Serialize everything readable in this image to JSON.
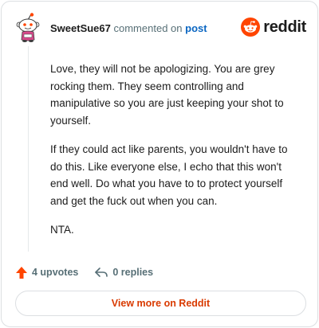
{
  "header": {
    "author": "SweetSue67",
    "commented_text": "commented on",
    "post_link": "post",
    "brand": "reddit"
  },
  "comment": {
    "paragraphs": [
      "Love, they will not be apologizing. You are grey rocking them. They seem controlling and manipulative so you are just keeping your shot to yourself.",
      "If they could act like parents, you wouldn't have to do this. Like everyone else, I echo that this won't end well. Do what you have to to protect yourself and get the fuck out when you can.",
      "NTA."
    ]
  },
  "actions": {
    "upvotes": "4 upvotes",
    "replies": "0 replies"
  },
  "footer": {
    "view_more": "View more on Reddit"
  },
  "colors": {
    "brand_orange": "#ff4500",
    "link_blue": "#0a66c2",
    "view_more_text": "#d93a00"
  },
  "icons": {
    "avatar": "snoo-avatar-icon",
    "brand": "reddit-logo-icon",
    "upvote": "upvote-arrow-icon",
    "reply": "reply-arrow-icon"
  }
}
